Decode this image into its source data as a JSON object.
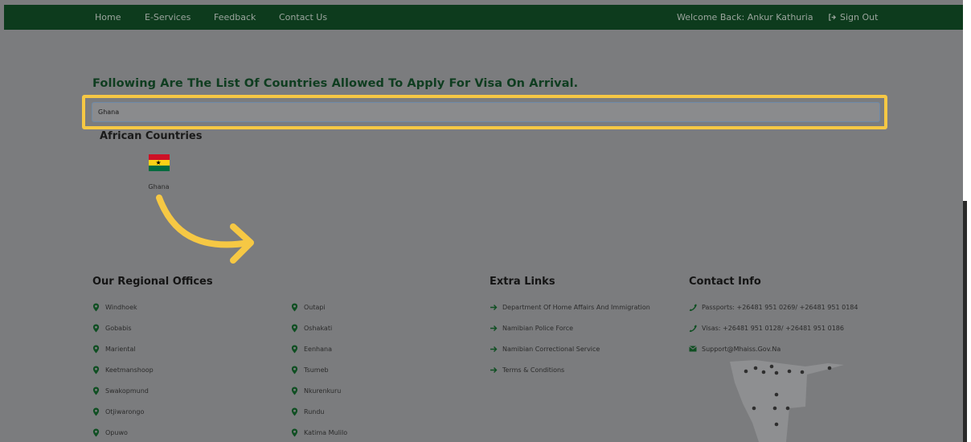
{
  "nav": {
    "links": [
      "Home",
      "E-Services",
      "Feedback",
      "Contact Us"
    ],
    "welcome": "Welcome Back: Ankur Kathuria",
    "sign_out": "Sign Out"
  },
  "heading": "Following Are The List Of Countries Allowed To Apply For Visa On Arrival.",
  "search": {
    "value": "Ghana"
  },
  "region_title": "African Countries",
  "countries": [
    {
      "name": "Ghana",
      "flag_colors": [
        "#ce1126",
        "#fcd116",
        "#006b3f"
      ]
    }
  ],
  "footer": {
    "offices_title": "Our Regional Offices",
    "offices_col1": [
      "Windhoek",
      "Gobabis",
      "Mariental",
      "Keetmanshoop",
      "Swakopmund",
      "Otjiwarongo",
      "Opuwo"
    ],
    "offices_col2": [
      "Outapi",
      "Oshakati",
      "Eenhana",
      "Tsumeb",
      "Nkurenkuru",
      "Rundu",
      "Katima Mulilo"
    ],
    "links_title": "Extra Links",
    "links": [
      "Department Of Home Affairs And Immigration",
      "Namibian Police Force",
      "Namibian Correctional Service",
      "Terms & Conditions"
    ],
    "contact_title": "Contact Info",
    "contact": [
      {
        "icon": "phone-icon",
        "text": "Passports: +26481 951 0269/ +26481 951 0184"
      },
      {
        "icon": "phone-icon",
        "text": "Visas: +26481 951 0128/ +26481 951 0186"
      },
      {
        "icon": "envelope-icon",
        "text": "Support@Mhaiss.Gov.Na"
      }
    ]
  },
  "colors": {
    "nav_bg": "#0d3b1d",
    "heading": "#0f3d20",
    "icon_green": "#0f4f22",
    "highlight": "#f6c844",
    "arrow": "#f6c844",
    "overlay_bg": "#7b7c7e"
  }
}
